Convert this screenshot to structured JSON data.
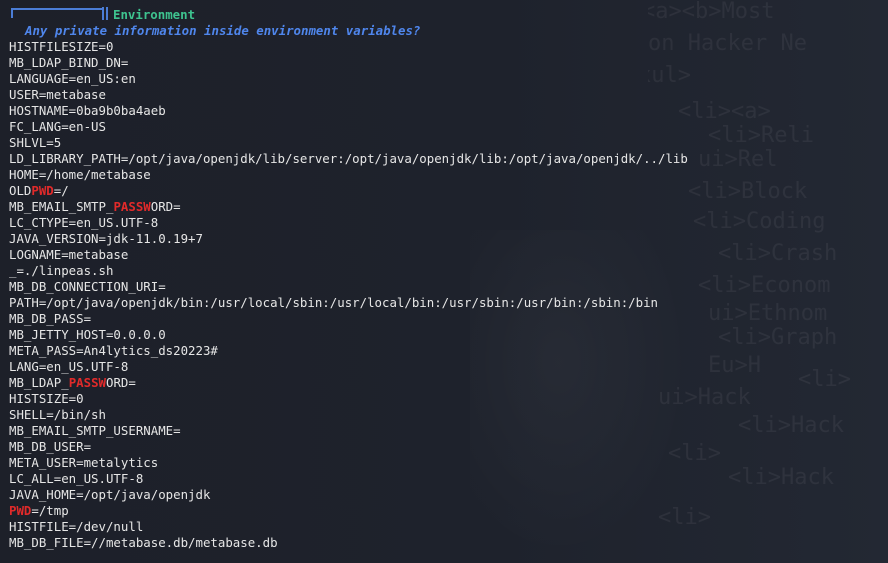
{
  "section": {
    "title": "Environment",
    "subtitle": "Any private information inside environment variables?"
  },
  "env_lines": [
    {
      "parts": [
        {
          "t": "HISTFILESIZE=0"
        }
      ]
    },
    {
      "parts": [
        {
          "t": "MB_LDAP_BIND_DN="
        }
      ]
    },
    {
      "parts": [
        {
          "t": "LANGUAGE=en_US:en"
        }
      ]
    },
    {
      "parts": [
        {
          "t": "USER=metabase"
        }
      ]
    },
    {
      "parts": [
        {
          "t": "HOSTNAME=0ba9b0ba4aeb"
        }
      ]
    },
    {
      "parts": [
        {
          "t": "FC_LANG=en-US"
        }
      ]
    },
    {
      "parts": [
        {
          "t": "SHLVL=5"
        }
      ]
    },
    {
      "parts": [
        {
          "t": "LD_LIBRARY_PATH=/opt/java/openjdk/lib/server:/opt/java/openjdk/lib:/opt/java/openjdk/../lib"
        }
      ]
    },
    {
      "parts": [
        {
          "t": "HOME=/home/metabase"
        }
      ]
    },
    {
      "parts": [
        {
          "t": "OLD"
        },
        {
          "t": "PWD",
          "hl": true
        },
        {
          "t": "=/"
        }
      ]
    },
    {
      "parts": [
        {
          "t": "MB_EMAIL_SMTP_"
        },
        {
          "t": "PASSW",
          "hl": true
        },
        {
          "t": "ORD="
        }
      ]
    },
    {
      "parts": [
        {
          "t": "LC_CTYPE=en_US.UTF-8"
        }
      ]
    },
    {
      "parts": [
        {
          "t": "JAVA_VERSION=jdk-11.0.19+7"
        }
      ]
    },
    {
      "parts": [
        {
          "t": "LOGNAME=metabase"
        }
      ]
    },
    {
      "parts": [
        {
          "t": "_=./linpeas.sh"
        }
      ]
    },
    {
      "parts": [
        {
          "t": "MB_DB_CONNECTION_URI="
        }
      ]
    },
    {
      "parts": [
        {
          "t": "PATH=/opt/java/openjdk/bin:/usr/local/sbin:/usr/local/bin:/usr/sbin:/usr/bin:/sbin:/bin"
        }
      ]
    },
    {
      "parts": [
        {
          "t": "MB_DB_PASS="
        }
      ]
    },
    {
      "parts": [
        {
          "t": "MB_JETTY_HOST=0.0.0.0"
        }
      ]
    },
    {
      "parts": [
        {
          "t": "META_PASS=An4lytics_ds20223#"
        }
      ]
    },
    {
      "parts": [
        {
          "t": "LANG=en_US.UTF-8"
        }
      ]
    },
    {
      "parts": [
        {
          "t": "MB_LDAP_"
        },
        {
          "t": "PASSW",
          "hl": true
        },
        {
          "t": "ORD="
        }
      ]
    },
    {
      "parts": [
        {
          "t": "HISTSIZE=0"
        }
      ]
    },
    {
      "parts": [
        {
          "t": "SHELL=/bin/sh"
        }
      ]
    },
    {
      "parts": [
        {
          "t": "MB_EMAIL_SMTP_USERNAME="
        }
      ]
    },
    {
      "parts": [
        {
          "t": "MB_DB_USER="
        }
      ]
    },
    {
      "parts": [
        {
          "t": "META_USER=metalytics"
        }
      ]
    },
    {
      "parts": [
        {
          "t": "LC_ALL=en_US.UTF-8"
        }
      ]
    },
    {
      "parts": [
        {
          "t": "JAVA_HOME=/opt/java/openjdk"
        }
      ]
    },
    {
      "parts": [
        {
          "t": "PWD",
          "hl": true
        },
        {
          "t": "=/tmp"
        }
      ]
    },
    {
      "parts": [
        {
          "t": "HISTFILE=/dev/null"
        }
      ]
    },
    {
      "parts": [
        {
          "t": "MB_DB_FILE=//metabase.db/metabase.db"
        }
      ]
    }
  ],
  "colors": {
    "background": "#1e222c",
    "text": "#e6e6e6",
    "section_title": "#3ec38f",
    "subtitle": "#4f86ec",
    "highlight": "#e12a2a",
    "header_box": "#4b7dd6"
  },
  "wallpaper_text": [
    "<a><b>Most",
    "on Hacker Ne",
    "xul>",
    "<li><a>",
    "<li>Reli",
    "ui>Rel",
    "<li>Block",
    "<li>Coding",
    "<li>Crash",
    "<li>Econom",
    "ui>Ethnom",
    "<li>Graph",
    "Eu>H",
    "<li>",
    "ui>Hack",
    "<li>Hack",
    "<li>",
    "<li>Hack",
    "<li>"
  ]
}
